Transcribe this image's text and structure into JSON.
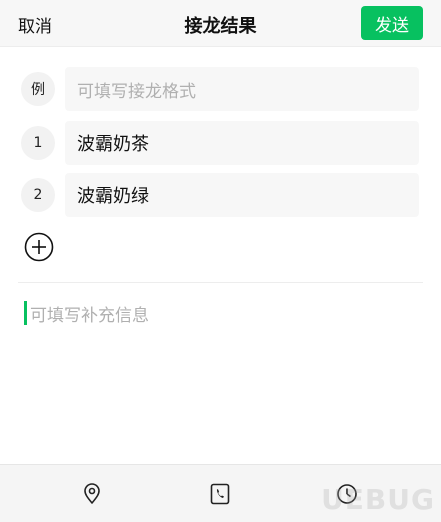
{
  "header": {
    "cancel_label": "取消",
    "title": "接龙结果",
    "send_label": "发送"
  },
  "entries": [
    {
      "badge": "例",
      "text": "可填写接龙格式",
      "is_placeholder": true
    },
    {
      "badge": "1",
      "text": "波霸奶茶",
      "is_placeholder": false
    },
    {
      "badge": "2",
      "text": "波霸奶绿",
      "is_placeholder": false
    }
  ],
  "supplement": {
    "placeholder": "可填写补充信息"
  },
  "toolbar": {
    "icons": [
      "location-icon",
      "phone-icon",
      "clock-icon"
    ]
  },
  "watermark": {
    "text": "UEBUG"
  },
  "colors": {
    "accent": "#07c160",
    "placeholder": "#b0b0b0",
    "field_bg": "#f7f7f7"
  }
}
